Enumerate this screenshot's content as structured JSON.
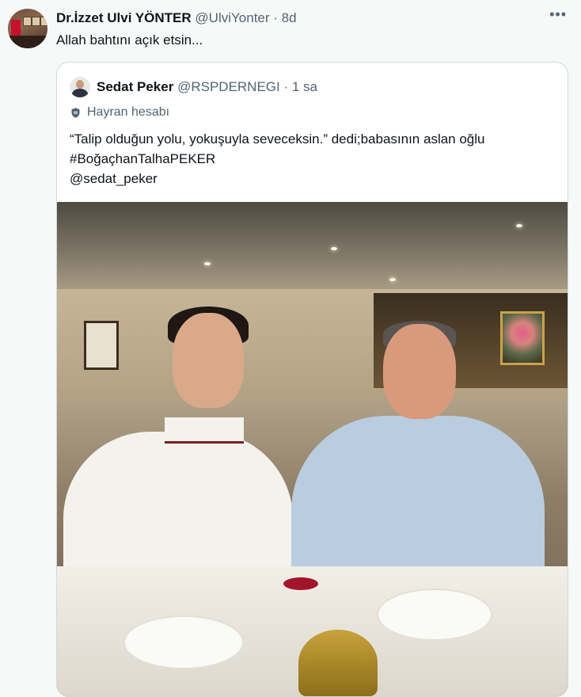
{
  "tweet": {
    "author_name": "Dr.İzzet Ulvi YÖNTER",
    "author_handle": "@UlviYonter",
    "separator": " · ",
    "time": "8d",
    "text": "Allah bahtını açık etsin...",
    "more_icon": "ellipsis-icon"
  },
  "quoted": {
    "author_name": "Sedat Peker",
    "author_handle": "@RSPDERNEGI",
    "separator": " · ",
    "time": "1 sa",
    "label": "Hayran hesabı",
    "label_icon": "shield-icon",
    "text_line1": "“Talip olduğun yolu, yokuşuyla seveceksin.” dedi;babasının aslan oğlu",
    "text_line2": "#BoğaçhanTalhaPEKER",
    "text_line3": "@sedat_peker"
  },
  "colors": {
    "background": "#f7f9f9",
    "text": "#0f1419",
    "secondary_text": "#536471",
    "border": "#cfd9de"
  }
}
